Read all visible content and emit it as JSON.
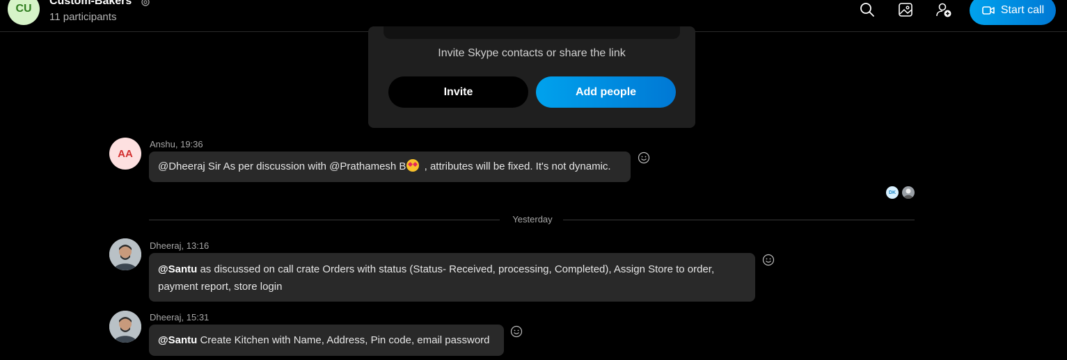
{
  "header": {
    "avatar_initials": "CU",
    "title": "Custom-Bakers",
    "participants": "11 participants",
    "start_call_label": "Start call",
    "icons": [
      "search-icon",
      "gallery-icon",
      "add-person-icon",
      "video-icon",
      "gear-icon"
    ]
  },
  "invite_card": {
    "text": "Invite Skype contacts or share the link",
    "invite_label": "Invite",
    "add_people_label": "Add people"
  },
  "messages": [
    {
      "author_meta": "Anshu, 19:36",
      "avatar_initials": "AA",
      "text_before_emoji": "@Dheeraj Sir As per discussion with @Prathamesh B",
      "text_after_emoji": " , attributes will be fixed. It's not dynamic."
    },
    {
      "author_meta": "Dheeraj, 13:16",
      "mention": "@Santu",
      "text": " as discussed on call crate Orders with status (Status- Received, processing, Completed), Assign Store to order, payment report, store login"
    },
    {
      "author_meta": "Dheeraj, 15:31",
      "mention": "@Santu",
      "text": " Create Kitchen with Name, Address, Pin code, email password"
    }
  ],
  "seen_by": {
    "initials": "DK"
  },
  "divider": {
    "label": "Yesterday"
  },
  "colors": {
    "accent_start": "#00a2ed",
    "accent_end": "#0078d4",
    "bubble": "#292929",
    "background": "#000000"
  }
}
